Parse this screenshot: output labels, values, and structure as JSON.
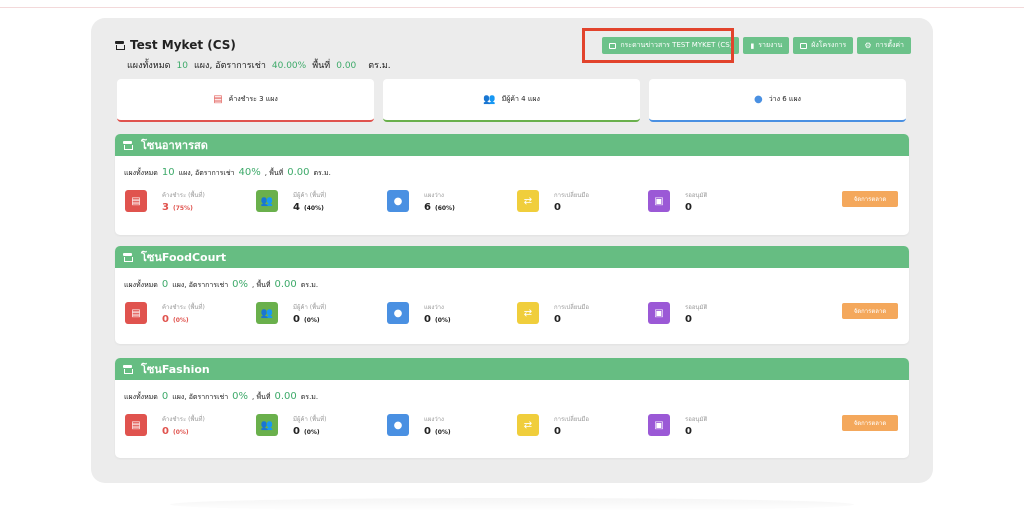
{
  "header": {
    "title": "Test Myket (CS)",
    "summary_label_total": "แผงทั้งหมด",
    "total_stalls": "10",
    "summary_label_rate": "แผง, อัตราการเช่า",
    "rent_rate": "40.00%",
    "summary_label_area": "พื้นที่",
    "area": "0.00",
    "area_unit": "ตร.ม."
  },
  "buttons": {
    "board": "กระดานข่าวสาร TEST MYKET (CS)",
    "report": "รายงาน",
    "plan": "ผังโครงการ",
    "settings": "การตั้งค่า"
  },
  "summary_tiles": [
    {
      "label": "ค้างชำระ 3 แผง",
      "icon": "invoice-icon",
      "accent": "#e0534e"
    },
    {
      "label": "มีผู้ค้า 4 แผง",
      "icon": "users-icon",
      "accent": "#6ab04c"
    },
    {
      "label": "ว่าง 6 แผง",
      "icon": "user-icon",
      "accent": "#4a90e2"
    }
  ],
  "zones": [
    {
      "name": "โซนอาหารสด",
      "sum_total_label": "แผงทั้งหมด",
      "total": "10",
      "sum_rate_label": "แผง, อัตราการเช่า",
      "rate": "40%",
      "sum_area_label": ", พื้นที่",
      "area": "0.00",
      "area_unit": "ตร.ม.",
      "stats": [
        {
          "label": "ค้างชำระ (พื้นที่)",
          "value": "3",
          "pct": "(75%)"
        },
        {
          "label": "มีผู้ค้า (พื้นที่)",
          "value": "4",
          "pct": "(40%)"
        },
        {
          "label": "แผงว่าง",
          "value": "6",
          "pct": "(60%)"
        },
        {
          "label": "การเปลี่ยนมือ",
          "value": "0"
        },
        {
          "label": "รออนุมัติ",
          "value": "0"
        }
      ],
      "manage_label": "จัดการตลาด"
    },
    {
      "name": "โซนFoodCourt",
      "sum_total_label": "แผงทั้งหมด",
      "total": "0",
      "sum_rate_label": "แผง, อัตราการเช่า",
      "rate": "0%",
      "sum_area_label": ", พื้นที่",
      "area": "0.00",
      "area_unit": "ตร.ม.",
      "stats": [
        {
          "label": "ค้างชำระ (พื้นที่)",
          "value": "0",
          "pct": "(0%)"
        },
        {
          "label": "มีผู้ค้า (พื้นที่)",
          "value": "0",
          "pct": "(0%)"
        },
        {
          "label": "แผงว่าง",
          "value": "0",
          "pct": "(0%)"
        },
        {
          "label": "การเปลี่ยนมือ",
          "value": "0"
        },
        {
          "label": "รออนุมัติ",
          "value": "0"
        }
      ],
      "manage_label": "จัดการตลาด"
    },
    {
      "name": "โซนFashion",
      "sum_total_label": "แผงทั้งหมด",
      "total": "0",
      "sum_rate_label": "แผง, อัตราการเช่า",
      "rate": "0%",
      "sum_area_label": ", พื้นที่",
      "area": "0.00",
      "area_unit": "ตร.ม.",
      "stats": [
        {
          "label": "ค้างชำระ (พื้นที่)",
          "value": "0",
          "pct": "(0%)"
        },
        {
          "label": "มีผู้ค้า (พื้นที่)",
          "value": "0",
          "pct": "(0%)"
        },
        {
          "label": "แผงว่าง",
          "value": "0",
          "pct": "(0%)"
        },
        {
          "label": "การเปลี่ยนมือ",
          "value": "0"
        },
        {
          "label": "รออนุมัติ",
          "value": "0"
        }
      ],
      "manage_label": "จัดการตลาด"
    }
  ],
  "colors": {
    "primary_green": "#66bd82",
    "highlight_red": "#e2432c",
    "manage_orange": "#f4a85c"
  }
}
